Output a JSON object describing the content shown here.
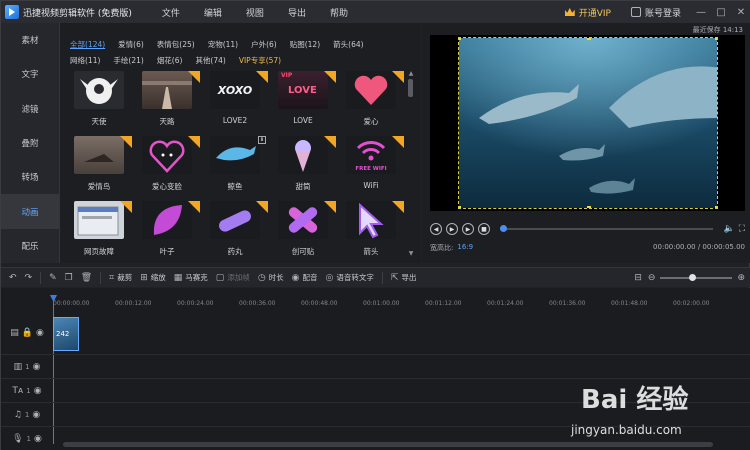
{
  "app": {
    "title": "迅捷视频剪辑软件 (免费版)",
    "menu": [
      "文件",
      "编辑",
      "视图",
      "导出",
      "帮助"
    ],
    "vip_label": "开通VIP",
    "login_label": "账号登录",
    "window_controls": [
      "—",
      "□",
      "✕"
    ]
  },
  "sidenav": {
    "items": [
      "素材",
      "文字",
      "滤镜",
      "叠附",
      "转场",
      "动画",
      "配乐"
    ],
    "active_index": 5
  },
  "library": {
    "tabs": [
      "全部(124)",
      "爱情(6)",
      "表情包(25)",
      "宠物(11)",
      "户外(6)",
      "贴图(12)",
      "箭头(64)",
      "网络(11)",
      "手绘(21)",
      "烟花(6)",
      "其他(74)",
      "VIP专享(57)"
    ],
    "active_tab": 0,
    "items": [
      {
        "label": "天使"
      },
      {
        "label": "天路"
      },
      {
        "label": "LOVE2"
      },
      {
        "label": "LOVE"
      },
      {
        "label": "爱心"
      },
      {
        "label": "爱情鸟"
      },
      {
        "label": "爱心变脸"
      },
      {
        "label": "鲸鱼"
      },
      {
        "label": "甜筒"
      },
      {
        "label": "WiFi"
      },
      {
        "label": "网页故障"
      },
      {
        "label": "叶子"
      },
      {
        "label": "药丸"
      },
      {
        "label": "创可贴"
      },
      {
        "label": "箭头"
      }
    ],
    "thumb_texts": {
      "love2": "XOXO",
      "love_vip": "VIP",
      "love": "LOVE",
      "wifi": "FREE WIFI"
    }
  },
  "preview": {
    "save_status": "最近保存 14:13",
    "aspect_label": "宽高比:",
    "aspect_value": "16:9",
    "timecode": "00:00:00.00 / 00:00:05.00",
    "progress": 0
  },
  "toolbar": {
    "tools": [
      {
        "label": "",
        "icon": "undo-icon",
        "enabled": true
      },
      {
        "label": "",
        "icon": "redo-icon",
        "enabled": false
      },
      {
        "label": "",
        "icon": "edit-icon",
        "enabled": false
      },
      {
        "label": "",
        "icon": "copy-icon",
        "enabled": false
      },
      {
        "label": "",
        "icon": "delete-icon",
        "enabled": true
      },
      {
        "label": "裁剪",
        "icon": "crop-icon",
        "enabled": true
      },
      {
        "label": "缩放",
        "icon": "zoom-icon",
        "enabled": true
      },
      {
        "label": "马赛克",
        "icon": "mosaic-icon",
        "enabled": true
      },
      {
        "label": "添加帧",
        "icon": "add-frame-icon",
        "enabled": false
      },
      {
        "label": "时长",
        "icon": "clock-icon",
        "enabled": true
      },
      {
        "label": "配音",
        "icon": "mic-icon",
        "enabled": true
      },
      {
        "label": "语音转文字",
        "icon": "speech-text-icon",
        "enabled": true
      },
      {
        "label": "导出",
        "icon": "export-icon",
        "enabled": true
      }
    ],
    "zoom_level": 0.45
  },
  "timeline": {
    "ruler": [
      "00:00:00.00",
      "00:00:12.00",
      "00:00:24.00",
      "00:00:36.00",
      "00:00:48.00",
      "00:01:00.00",
      "00:01:12.00",
      "00:01:24.00",
      "00:01:36.00",
      "00:01:48.00",
      "00:02:00.00"
    ],
    "tracks": [
      {
        "name": "video-track",
        "label": ""
      },
      {
        "name": "overlay-track",
        "label": "1"
      },
      {
        "name": "text-track",
        "label": "1"
      },
      {
        "name": "music-track",
        "label": "1"
      },
      {
        "name": "voice-track",
        "label": "1"
      }
    ],
    "clip_label": "242"
  },
  "watermark": {
    "brand": "Bai 经验",
    "url": "jingyan.baidu.com"
  },
  "colors": {
    "accent": "#5aa3ff",
    "vip": "#f0b94a",
    "badge": "#f3a623",
    "selection": "#d9d23a"
  }
}
